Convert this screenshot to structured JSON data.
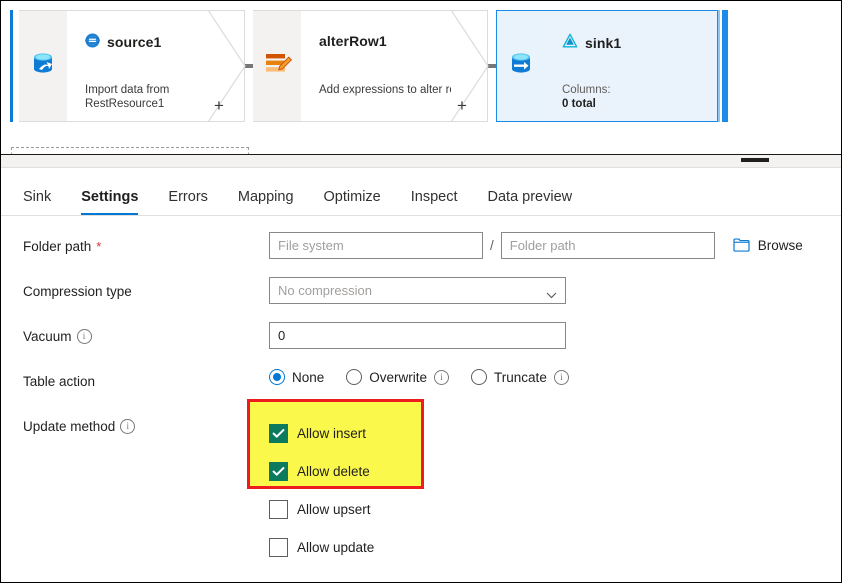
{
  "canvas": {
    "nodes": [
      {
        "id": "source1",
        "title": "source1",
        "subtitle": "Import data from\nRestResource1",
        "icon": "rest-source-icon",
        "cylinder_icon": "database-source-cylinder-icon"
      },
      {
        "id": "alterRow1",
        "title": "alterRow1",
        "subtitle": "Add expressions to alter rows",
        "icon": "alter-row-icon"
      },
      {
        "id": "sink1",
        "title": "sink1",
        "icon": "delta-lake-icon",
        "cylinder_icon": "database-sink-cylinder-icon",
        "columns_label": "Columns:",
        "columns_value": "0 total"
      }
    ],
    "add_connector_label": "+"
  },
  "tabs": [
    {
      "label": "Sink",
      "active": false
    },
    {
      "label": "Settings",
      "active": true
    },
    {
      "label": "Errors",
      "active": false
    },
    {
      "label": "Mapping",
      "active": false
    },
    {
      "label": "Optimize",
      "active": false
    },
    {
      "label": "Inspect",
      "active": false
    },
    {
      "label": "Data preview",
      "active": false
    }
  ],
  "settings": {
    "folder_path": {
      "label": "Folder path",
      "required_marker": "*",
      "file_system_placeholder": "File system",
      "file_system_value": "",
      "separator": "/",
      "folder_path_placeholder": "Folder path",
      "folder_path_value": "",
      "browse_label": "Browse"
    },
    "compression_type": {
      "label": "Compression type",
      "value": "No compression"
    },
    "vacuum": {
      "label": "Vacuum",
      "value": "0",
      "info_tooltip": "i"
    },
    "table_action": {
      "label": "Table action",
      "options": [
        {
          "label": "None",
          "selected": true,
          "info": false
        },
        {
          "label": "Overwrite",
          "selected": false,
          "info": true
        },
        {
          "label": "Truncate",
          "selected": false,
          "info": true
        }
      ]
    },
    "update_method": {
      "label": "Update method",
      "info_tooltip": "i",
      "options": [
        {
          "label": "Allow insert",
          "checked": true,
          "highlighted": true
        },
        {
          "label": "Allow delete",
          "checked": true,
          "highlighted": true
        },
        {
          "label": "Allow upsert",
          "checked": false,
          "highlighted": false
        },
        {
          "label": "Allow update",
          "checked": false,
          "highlighted": false
        }
      ]
    }
  },
  "colors": {
    "accent_blue": "#0078d4",
    "selected_node_border": "#1b8ae8",
    "selected_node_fill": "#eaf3fc",
    "checkbox_checked": "#0b7a5d",
    "highlight_fill": "#fbf84c",
    "highlight_border": "#ee1c1c",
    "required_red": "#d13438",
    "alter_row_orange": "#d95f0e",
    "delta_cyan": "#0fb5d8"
  }
}
